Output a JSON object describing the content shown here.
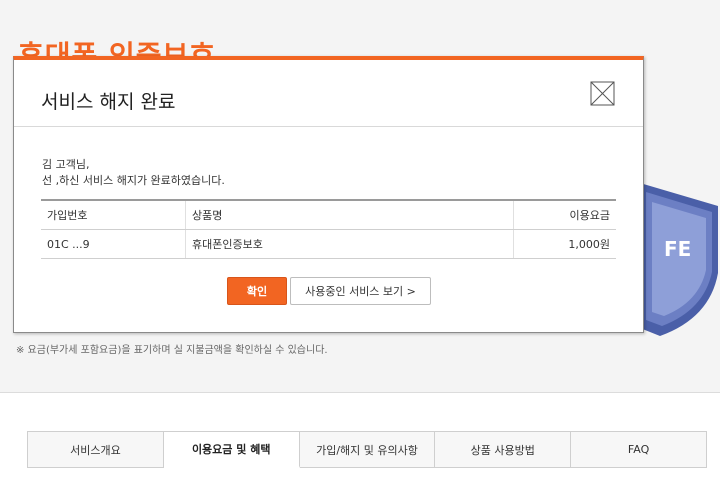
{
  "page": {
    "title": "휴대폰 인증보호",
    "notice": "※ 요금(부가세 포함요금)을 표기하며 실 지불금액을 확인하실 수 있습니다."
  },
  "modal": {
    "title": "서비스 해지 완료",
    "greeting_line1": "김      고객님,",
    "greeting_line2": "선  ,하신 서비스 해지가 완료하였습니다.",
    "table": {
      "headers": [
        "가입번호",
        "상품명",
        "이용요금"
      ],
      "rows": [
        [
          "01C        ...9",
          "휴대폰인증보호",
          "1,000원"
        ]
      ]
    },
    "confirm_label": "확인",
    "view_services_label": "사용중인 서비스 보기 >"
  },
  "tabs": [
    {
      "label": "서비스개요",
      "active": false
    },
    {
      "label": "이용요금 및 혜택",
      "active": true
    },
    {
      "label": "가입/해지 및 유의사항",
      "active": false
    },
    {
      "label": "상품 사용방법",
      "active": false
    },
    {
      "label": "FAQ",
      "active": false
    }
  ],
  "colors": {
    "accent": "#f26522",
    "shield": "#4a5fa8"
  },
  "shield_text": "FE"
}
